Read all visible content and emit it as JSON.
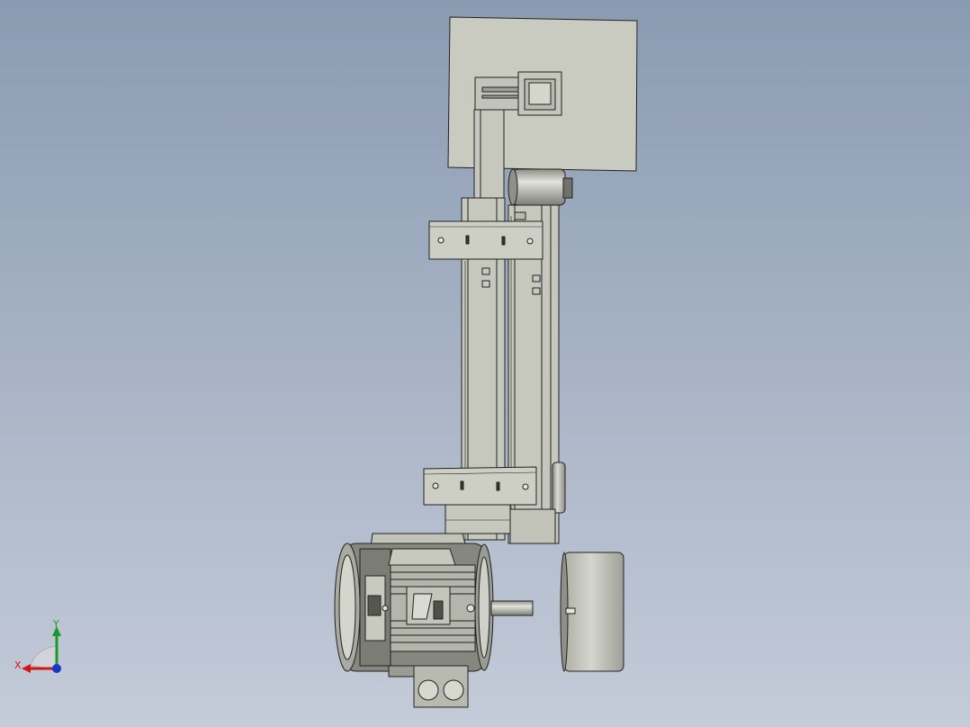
{
  "viewport": {
    "background_top": "#8a9bb1",
    "background_bottom": "#c4cbd9"
  },
  "model": {
    "name": "belt-grinder-assembly",
    "part_fill": "#c9cac0",
    "part_fill_dark": "#b7b8ad",
    "edge_color": "#222222",
    "motor_dark": "#55574f"
  },
  "triad": {
    "x_label": "X",
    "y_label": "Y",
    "x_color": "#d01818",
    "y_color": "#1a9a2a",
    "z_color": "#1836c8"
  }
}
